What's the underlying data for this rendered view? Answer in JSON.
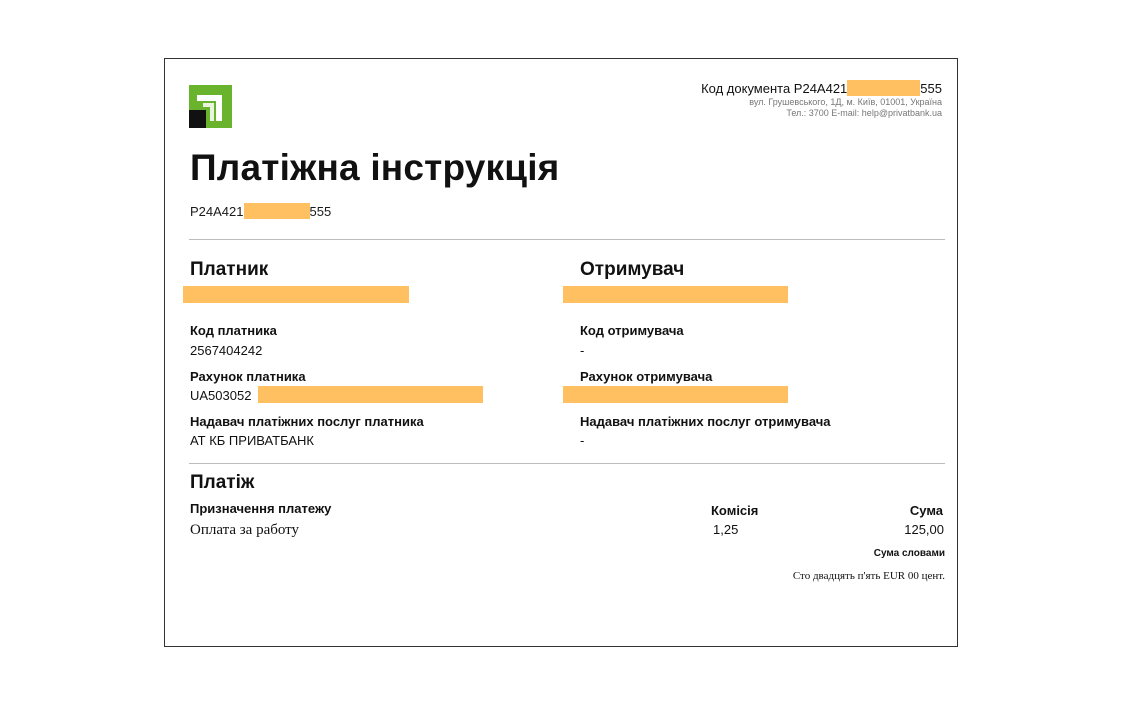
{
  "header": {
    "doc_code_label": "Код документа P24A421",
    "doc_code_suffix": "555",
    "address": "вул. Грушевського, 1Д, м. Київ, 01001, Україна",
    "contacts": "Тел.: 3700  E-mail: help@privatbank.ua"
  },
  "title": "Платіжна інструкція",
  "doc_number": {
    "prefix": "P24A421",
    "suffix": "555"
  },
  "payer": {
    "heading": "Платник",
    "code_label": "Код платника",
    "code_value": "2567404242",
    "account_label": "Рахунок платника",
    "account_prefix": "UA503052",
    "provider_label": "Надавач платіжних послуг платника",
    "provider_value": "АТ КБ ПРИВАТБАНК"
  },
  "recipient": {
    "heading": "Отримувач",
    "code_label": "Код отримувача",
    "code_value": "-",
    "account_label": "Рахунок отримувача",
    "provider_label": "Надавач платіжних послуг отримувача",
    "provider_value": "-"
  },
  "payment": {
    "heading": "Платіж",
    "purpose_label": "Призначення платежу",
    "purpose_value": "Оплата за работу",
    "commission_label": "Комісія",
    "commission_value": "1,25",
    "amount_label": "Сума",
    "amount_value": "125,00",
    "amount_words_label": "Сума словами",
    "amount_words_value": "Сто двадцять п'ять EUR 00 цент."
  },
  "colors": {
    "logo_green": "#6ab42d",
    "redaction": "#ffc061"
  }
}
